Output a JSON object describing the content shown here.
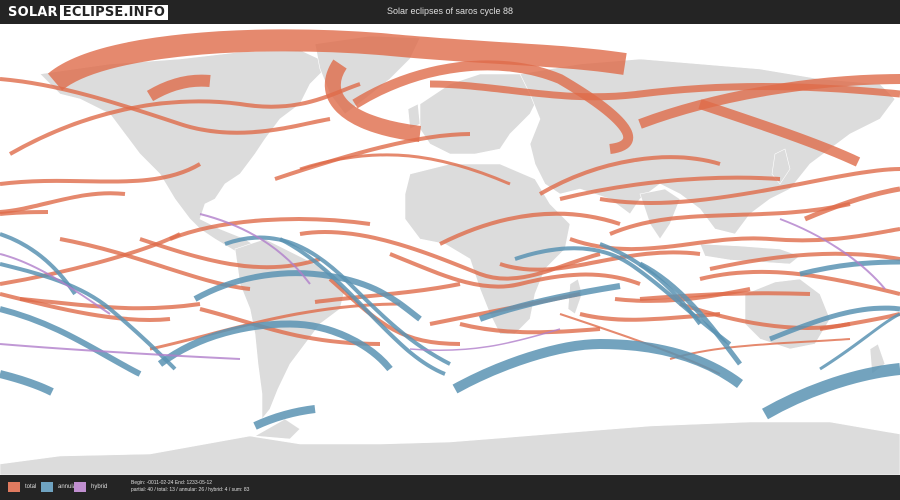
{
  "header": {
    "logo_left": "SOLAR",
    "logo_right": "ECLIPSE.INFO",
    "title": "Solar eclipses of saros cycle 88"
  },
  "legend": [
    {
      "label": "total",
      "color": "#e07a5f"
    },
    {
      "label": "annular",
      "color": "#6fa3c1"
    },
    {
      "label": "hybrid",
      "color": "#c08fd0"
    }
  ],
  "info": {
    "line1": "Begin: -0011-02-24 End: 1233-05-12",
    "line2": "partial: 40 / total: 13 / annular: 26 / hybrid: 4 / sum: 83"
  },
  "colors": {
    "total": "#de6b4a",
    "annular": "#5a93b3",
    "hybrid": "#b07ecb",
    "land": "#dcdcdc",
    "ocean": "#ffffff",
    "bar": "#242424"
  }
}
